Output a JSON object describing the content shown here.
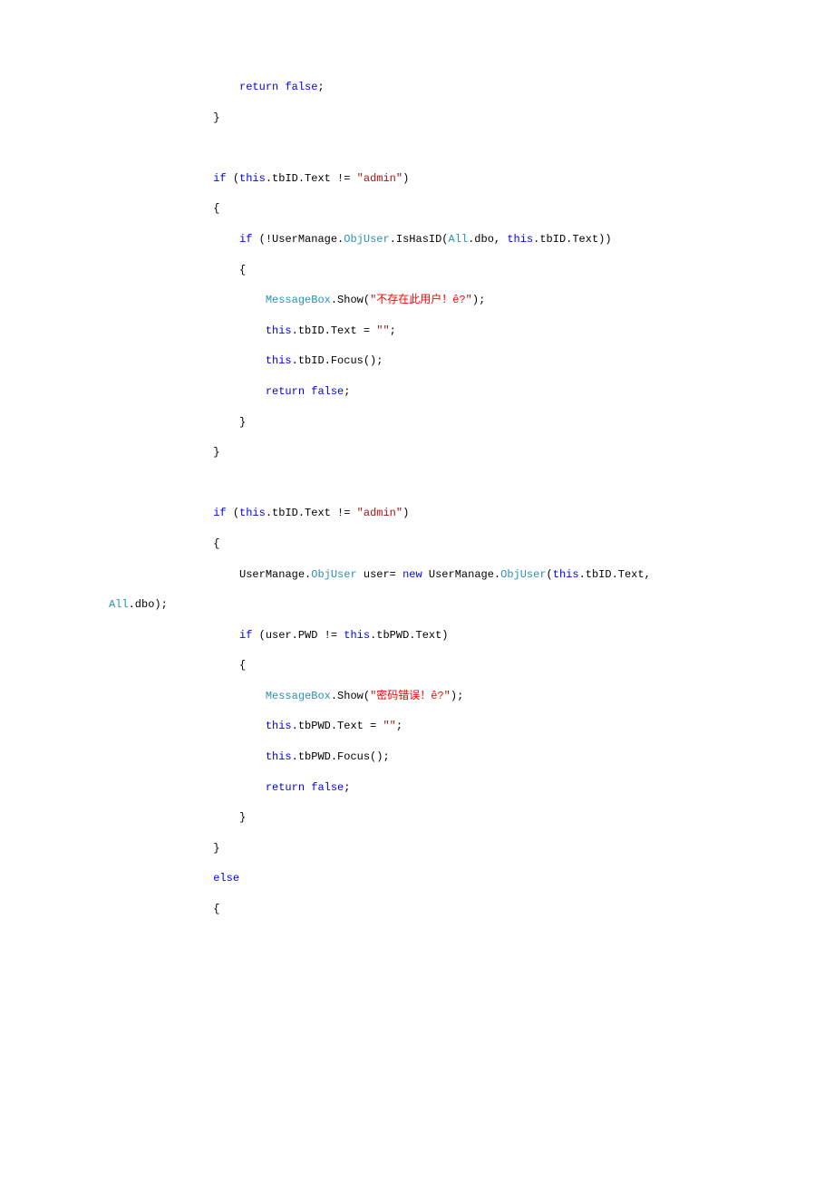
{
  "code": {
    "l1": {
      "indent": 5,
      "parts": [
        {
          "t": "return",
          "c": "kw"
        },
        {
          "t": " ",
          "c": "blk"
        },
        {
          "t": "false",
          "c": "kw"
        },
        {
          "t": ";",
          "c": "blk"
        }
      ]
    },
    "l2": {
      "indent": 4,
      "parts": [
        {
          "t": "}",
          "c": "blk"
        }
      ]
    },
    "l3": {
      "indent": 0,
      "parts": []
    },
    "l4": {
      "indent": 4,
      "parts": [
        {
          "t": "if",
          "c": "kw"
        },
        {
          "t": " (",
          "c": "blk"
        },
        {
          "t": "this",
          "c": "kw"
        },
        {
          "t": ".tbID.Text != ",
          "c": "blk"
        },
        {
          "t": "\"admin\"",
          "c": "str"
        },
        {
          "t": ")",
          "c": "blk"
        }
      ]
    },
    "l5": {
      "indent": 4,
      "parts": [
        {
          "t": "{",
          "c": "blk"
        }
      ]
    },
    "l6": {
      "indent": 5,
      "parts": [
        {
          "t": "if",
          "c": "kw"
        },
        {
          "t": " (!UserManage.",
          "c": "blk"
        },
        {
          "t": "ObjUser",
          "c": "cls"
        },
        {
          "t": ".IsHasID(",
          "c": "blk"
        },
        {
          "t": "All",
          "c": "cls"
        },
        {
          "t": ".dbo, ",
          "c": "blk"
        },
        {
          "t": "this",
          "c": "kw"
        },
        {
          "t": ".tbID.Text))",
          "c": "blk"
        }
      ]
    },
    "l7": {
      "indent": 5,
      "parts": [
        {
          "t": "{",
          "c": "blk"
        }
      ]
    },
    "l8": {
      "indent": 6,
      "parts": [
        {
          "t": "MessageBox",
          "c": "cls"
        },
        {
          "t": ".Show(",
          "c": "blk"
        },
        {
          "t": "\"",
          "c": "str"
        },
        {
          "t": "不存在此用户！ê?",
          "c": "str-cn"
        },
        {
          "t": "\"",
          "c": "str"
        },
        {
          "t": ");",
          "c": "blk"
        }
      ]
    },
    "l9": {
      "indent": 6,
      "parts": [
        {
          "t": "this",
          "c": "kw"
        },
        {
          "t": ".tbID.Text = ",
          "c": "blk"
        },
        {
          "t": "\"\"",
          "c": "str"
        },
        {
          "t": ";",
          "c": "blk"
        }
      ]
    },
    "l10": {
      "indent": 6,
      "parts": [
        {
          "t": "this",
          "c": "kw"
        },
        {
          "t": ".tbID.Focus();",
          "c": "blk"
        }
      ]
    },
    "l11": {
      "indent": 6,
      "parts": [
        {
          "t": "return",
          "c": "kw"
        },
        {
          "t": " ",
          "c": "blk"
        },
        {
          "t": "false",
          "c": "kw"
        },
        {
          "t": ";",
          "c": "blk"
        }
      ]
    },
    "l12": {
      "indent": 5,
      "parts": [
        {
          "t": "}",
          "c": "blk"
        }
      ]
    },
    "l13": {
      "indent": 4,
      "parts": [
        {
          "t": "}",
          "c": "blk"
        }
      ]
    },
    "l14": {
      "indent": 0,
      "parts": []
    },
    "l15": {
      "indent": 4,
      "parts": [
        {
          "t": "if",
          "c": "kw"
        },
        {
          "t": " (",
          "c": "blk"
        },
        {
          "t": "this",
          "c": "kw"
        },
        {
          "t": ".tbID.Text != ",
          "c": "blk"
        },
        {
          "t": "\"admin\"",
          "c": "str"
        },
        {
          "t": ")",
          "c": "blk"
        }
      ]
    },
    "l16": {
      "indent": 4,
      "parts": [
        {
          "t": "{",
          "c": "blk"
        }
      ]
    },
    "l17": {
      "indent": 5,
      "parts": [
        {
          "t": "UserManage.",
          "c": "blk"
        },
        {
          "t": "ObjUser",
          "c": "cls"
        },
        {
          "t": " user= ",
          "c": "blk"
        },
        {
          "t": "new",
          "c": "kw"
        },
        {
          "t": " UserManage.",
          "c": "blk"
        },
        {
          "t": "ObjUser",
          "c": "cls"
        },
        {
          "t": "(",
          "c": "blk"
        },
        {
          "t": "this",
          "c": "kw"
        },
        {
          "t": ".tbID.Text,",
          "c": "blk"
        }
      ]
    },
    "l17b": {
      "indent": 0,
      "flush": true,
      "parts": [
        {
          "t": "All",
          "c": "cls"
        },
        {
          "t": ".dbo);",
          "c": "blk"
        }
      ]
    },
    "l18": {
      "indent": 5,
      "parts": [
        {
          "t": "if",
          "c": "kw"
        },
        {
          "t": " (user.PWD != ",
          "c": "blk"
        },
        {
          "t": "this",
          "c": "kw"
        },
        {
          "t": ".tbPWD.Text)",
          "c": "blk"
        }
      ]
    },
    "l19": {
      "indent": 5,
      "parts": [
        {
          "t": "{",
          "c": "blk"
        }
      ]
    },
    "l20": {
      "indent": 6,
      "parts": [
        {
          "t": "MessageBox",
          "c": "cls"
        },
        {
          "t": ".Show(",
          "c": "blk"
        },
        {
          "t": "\"",
          "c": "str"
        },
        {
          "t": "密码错误！ê?",
          "c": "str-cn"
        },
        {
          "t": "\"",
          "c": "str"
        },
        {
          "t": ");",
          "c": "blk"
        }
      ]
    },
    "l21": {
      "indent": 6,
      "parts": [
        {
          "t": "this",
          "c": "kw"
        },
        {
          "t": ".tbPWD.Text = ",
          "c": "blk"
        },
        {
          "t": "\"\"",
          "c": "str"
        },
        {
          "t": ";",
          "c": "blk"
        }
      ]
    },
    "l22": {
      "indent": 6,
      "parts": [
        {
          "t": "this",
          "c": "kw"
        },
        {
          "t": ".tbPWD.Focus();",
          "c": "blk"
        }
      ]
    },
    "l23": {
      "indent": 6,
      "parts": [
        {
          "t": "return",
          "c": "kw"
        },
        {
          "t": " ",
          "c": "blk"
        },
        {
          "t": "false",
          "c": "kw"
        },
        {
          "t": ";",
          "c": "blk"
        }
      ]
    },
    "l24": {
      "indent": 5,
      "parts": [
        {
          "t": "}",
          "c": "blk"
        }
      ]
    },
    "l25": {
      "indent": 4,
      "parts": [
        {
          "t": "}",
          "c": "blk"
        }
      ]
    },
    "l26": {
      "indent": 4,
      "parts": [
        {
          "t": "else",
          "c": "kw"
        }
      ]
    },
    "l27": {
      "indent": 4,
      "parts": [
        {
          "t": "{",
          "c": "blk"
        }
      ]
    }
  },
  "order": [
    "l1",
    "l2",
    "l3",
    "l4",
    "l5",
    "l6",
    "l7",
    "l8",
    "l9",
    "l10",
    "l11",
    "l12",
    "l13",
    "l14",
    "l15",
    "l16",
    "l17",
    "l17b",
    "l18",
    "l19",
    "l20",
    "l21",
    "l22",
    "l23",
    "l24",
    "l25",
    "l26",
    "l27"
  ]
}
